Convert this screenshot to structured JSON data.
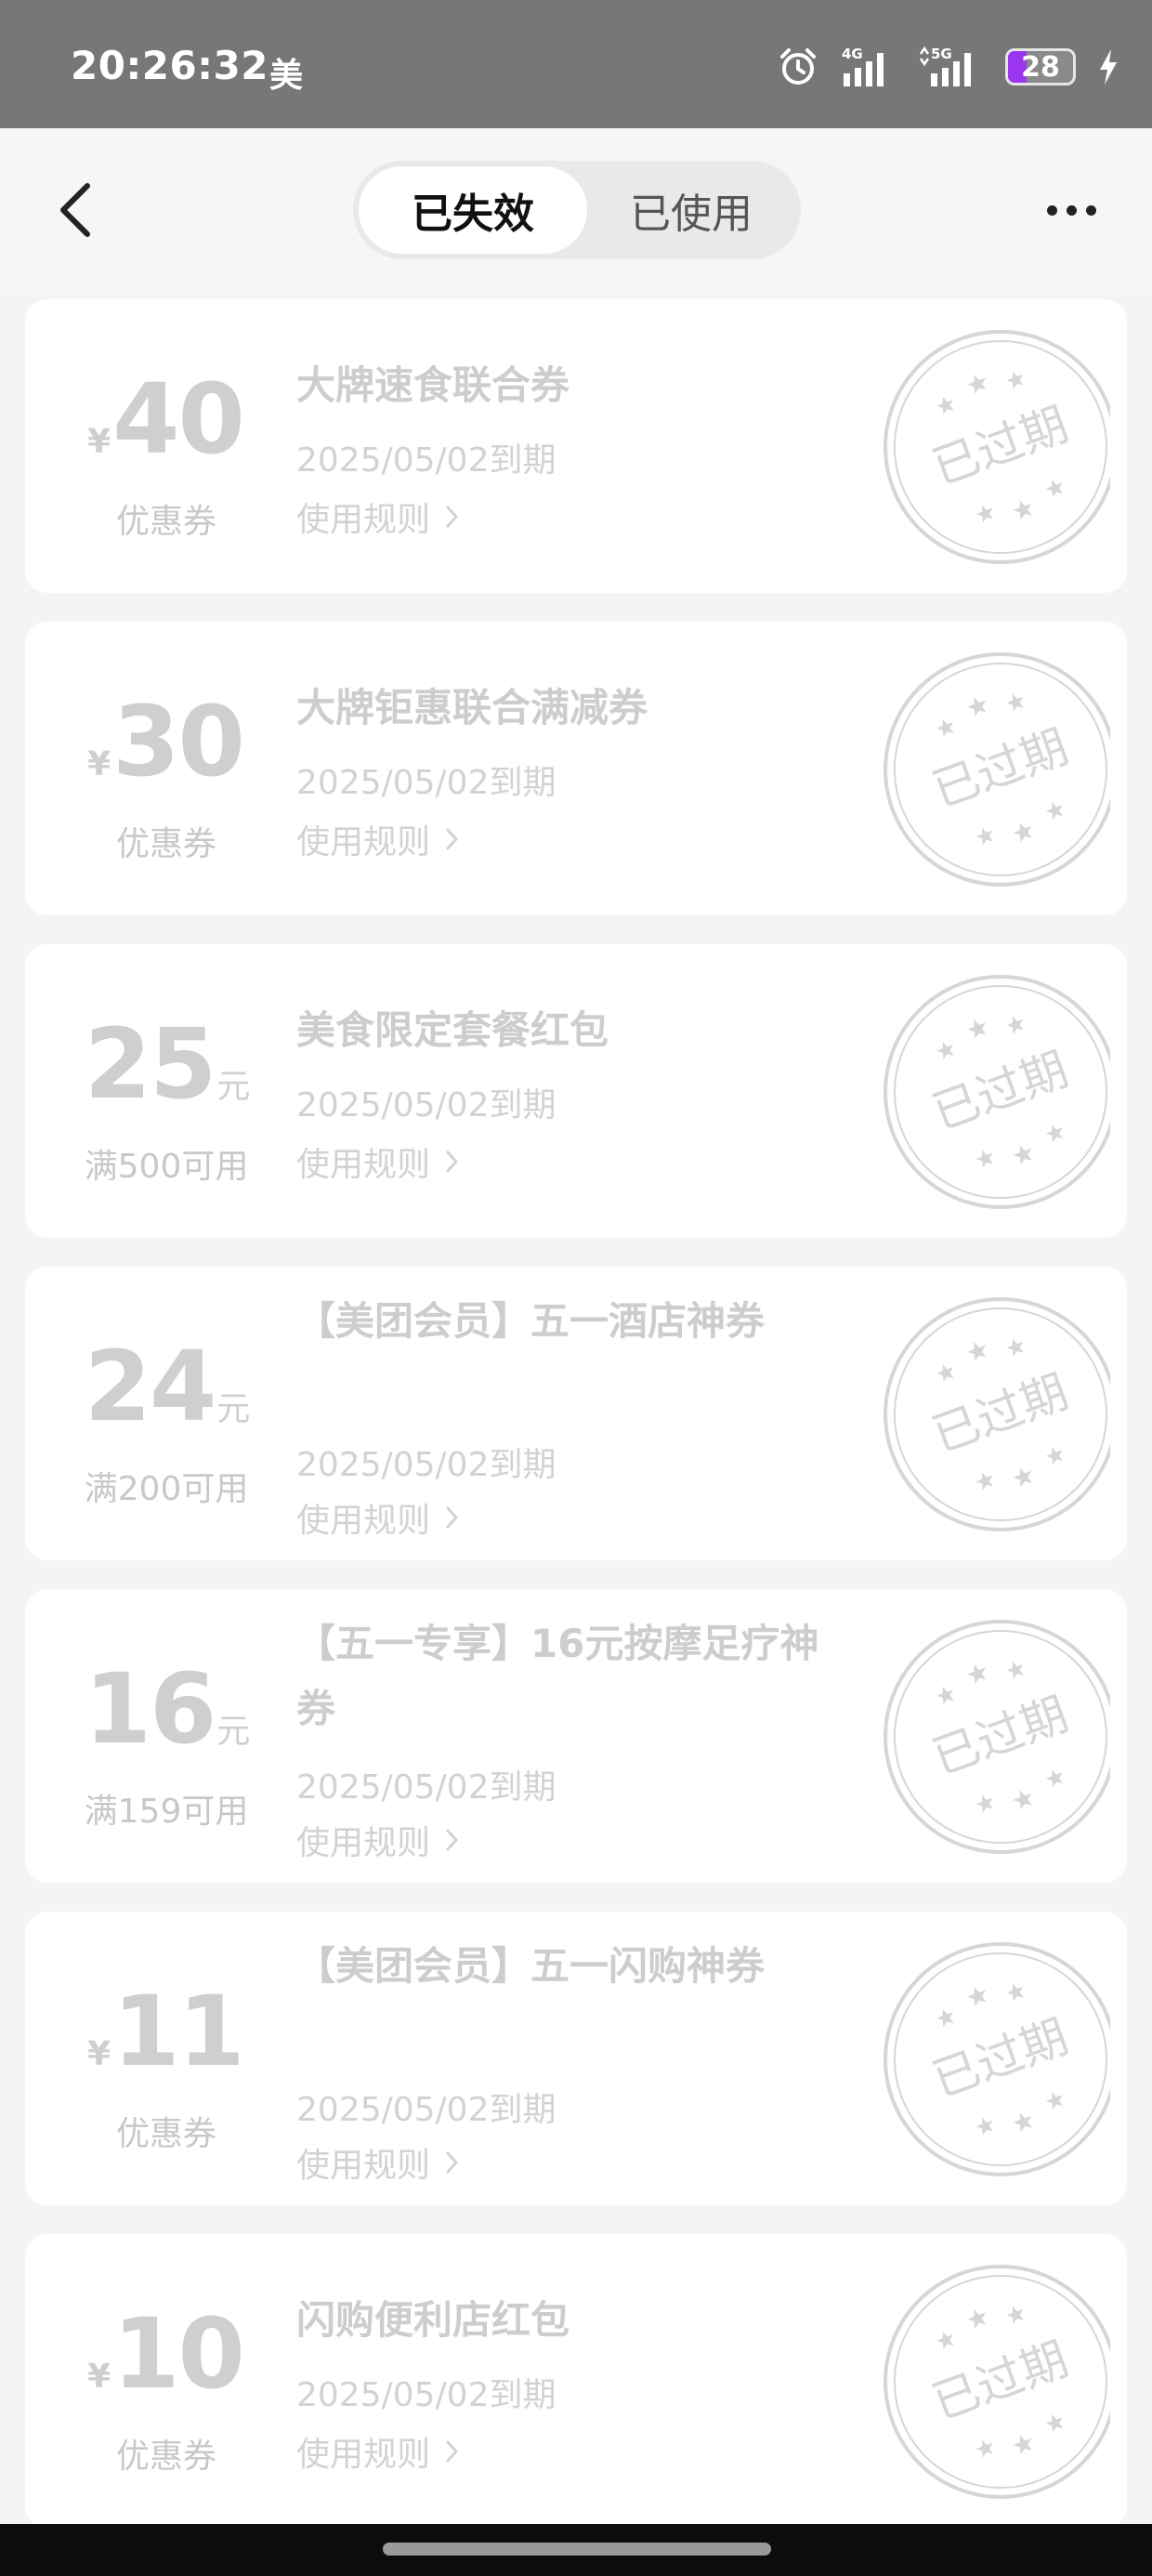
{
  "status_bar": {
    "time": "20:26:32",
    "app_indicator": "美",
    "network_1": "4G",
    "network_2": "5G",
    "battery_level": "28",
    "battery_fraction": 0.28,
    "battery_color": "#9b35f0"
  },
  "header": {
    "tabs": [
      {
        "label": "已失效",
        "active": true
      },
      {
        "label": "已使用",
        "active": false
      }
    ]
  },
  "coupons": [
    {
      "currency": "¥",
      "amount": "40",
      "unit": "",
      "subtitle": "优惠券",
      "title": "大牌速食联合券",
      "expiry": "2025/05/02到期",
      "rules": "使用规则",
      "stamp": "已过期"
    },
    {
      "currency": "¥",
      "amount": "30",
      "unit": "",
      "subtitle": "优惠券",
      "title": "大牌钜惠联合满减券",
      "expiry": "2025/05/02到期",
      "rules": "使用规则",
      "stamp": "已过期"
    },
    {
      "currency": "",
      "amount": "25",
      "unit": "元",
      "subtitle": "满500可用",
      "title": "美食限定套餐红包",
      "expiry": "2025/05/02到期",
      "rules": "使用规则",
      "stamp": "已过期"
    },
    {
      "currency": "",
      "amount": "24",
      "unit": "元",
      "subtitle": "满200可用",
      "title": "【美团会员】五一酒店神券",
      "expiry": "2025/05/02到期",
      "rules": "使用规则",
      "stamp": "已过期"
    },
    {
      "currency": "",
      "amount": "16",
      "unit": "元",
      "subtitle": "满159可用",
      "title": "【五一专享】16元按摩足疗神券",
      "expiry": "2025/05/02到期",
      "rules": "使用规则",
      "stamp": "已过期"
    },
    {
      "currency": "¥",
      "amount": "11",
      "unit": "",
      "subtitle": "优惠券",
      "title": "【美团会员】五一闪购神券",
      "expiry": "2025/05/02到期",
      "rules": "使用规则",
      "stamp": "已过期"
    },
    {
      "currency": "¥",
      "amount": "10",
      "unit": "",
      "subtitle": "优惠券",
      "title": "闪购便利店红包",
      "expiry": "2025/05/02到期",
      "rules": "使用规则",
      "stamp": "已过期"
    }
  ]
}
